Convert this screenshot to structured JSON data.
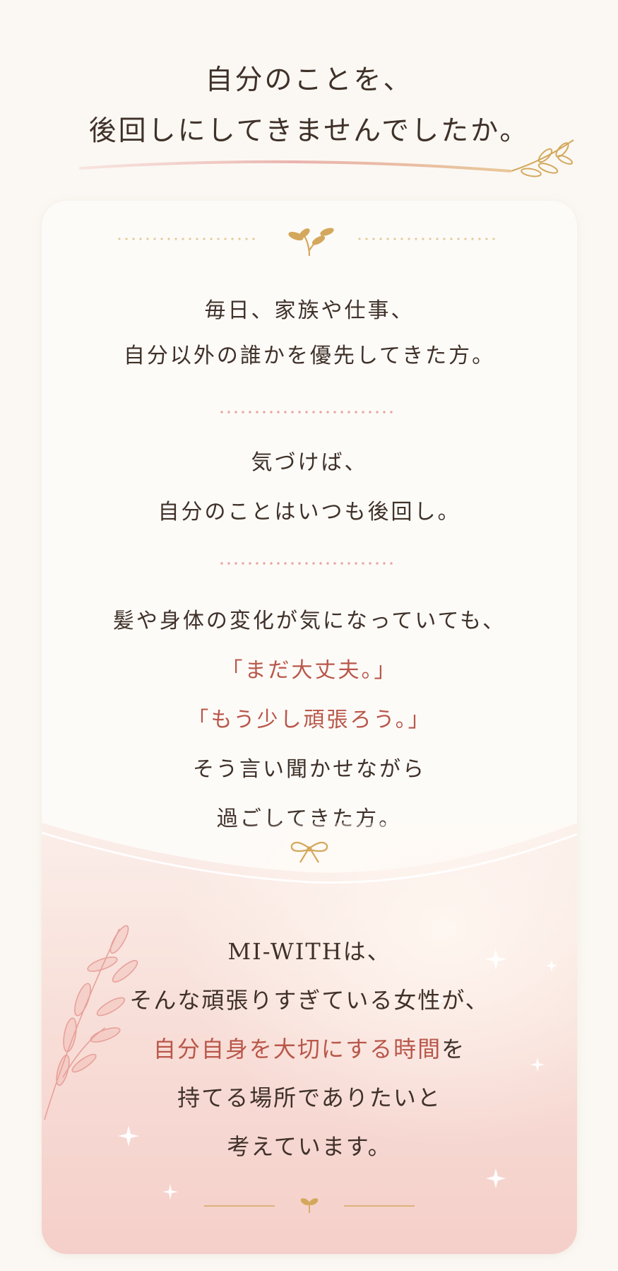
{
  "headline": {
    "line1": "自分のことを、",
    "line2": "後回しにしてきませんでしたか。"
  },
  "section1": {
    "line1": "毎日、家族や仕事、",
    "line2": "自分以外の誰かを優先してきた方。"
  },
  "section2": {
    "line1": "気づけば、",
    "line2": "自分のことはいつも後回し。"
  },
  "section3": {
    "line1": "髪や身体の変化が気になっていても、",
    "quote1": "「まだ大丈夫。」",
    "quote2": "「もう少し頑張ろう。」",
    "line4": "そう言い聞かせながら",
    "line5": "過ごしてきた方。"
  },
  "message": {
    "line1": "MI-WITHは、",
    "line2": "そんな頑張りすぎている女性が、",
    "highlight": "自分自身を大切にする時間",
    "highlight_suffix": "を",
    "line4": "持てる場所でありたいと",
    "line5": "考えています。"
  },
  "colors": {
    "accent": "#b9574a",
    "gold": "#d4a85c",
    "pink_dots": "#e8a6a2",
    "background": "#fbf8f3"
  },
  "icons": [
    "leaf-sprig-icon",
    "sprout-icon",
    "ribbon-bow-icon",
    "branch-illustration-icon",
    "small-sprout-icon"
  ]
}
